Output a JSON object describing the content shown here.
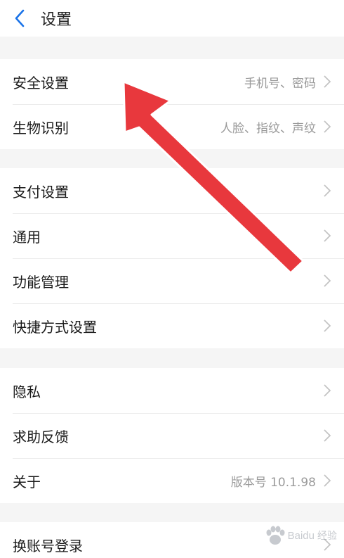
{
  "header": {
    "title": "设置",
    "back_icon": "chevron-left-icon"
  },
  "groups": [
    {
      "items": [
        {
          "label": "安全设置",
          "value": "手机号、密码"
        },
        {
          "label": "生物识别",
          "value": "人脸、指纹、声纹"
        }
      ]
    },
    {
      "items": [
        {
          "label": "支付设置",
          "value": ""
        },
        {
          "label": "通用",
          "value": ""
        },
        {
          "label": "功能管理",
          "value": ""
        },
        {
          "label": "快捷方式设置",
          "value": ""
        }
      ]
    },
    {
      "items": [
        {
          "label": "隐私",
          "value": ""
        },
        {
          "label": "求助反馈",
          "value": ""
        },
        {
          "label": "关于",
          "value": "版本号 10.1.98"
        }
      ]
    },
    {
      "items": [
        {
          "label": "换账号登录",
          "value": ""
        }
      ]
    }
  ],
  "watermark": {
    "text": "Baidu",
    "sub": "经验"
  },
  "colors": {
    "accent": "#1a73e8",
    "arrow": "#e8383d",
    "background": "#f5f5f5"
  }
}
